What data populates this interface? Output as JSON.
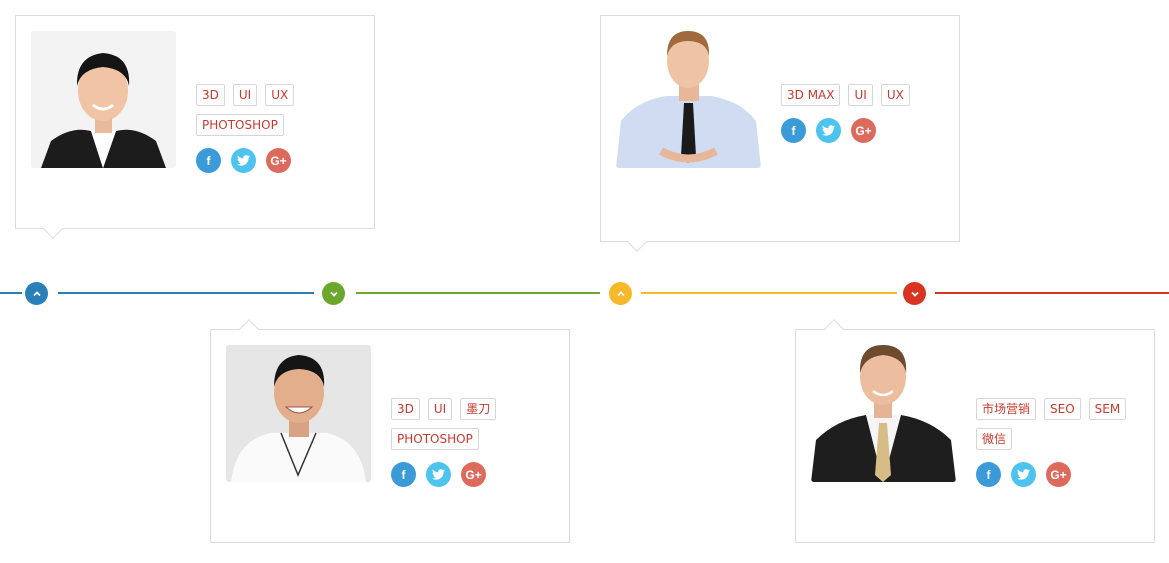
{
  "colors": {
    "blue": "#2980b9",
    "green": "#6aa72a",
    "yellow": "#f7b82a",
    "red": "#d93321",
    "tag_text": "#c83a2e"
  },
  "timeline": {
    "nodes": [
      {
        "color": "#2980b9",
        "icon": "chevron-up-icon"
      },
      {
        "color": "#6aa72a",
        "icon": "chevron-down-icon"
      },
      {
        "color": "#f7b82a",
        "icon": "chevron-up-icon"
      },
      {
        "color": "#d93321",
        "icon": "chevron-down-icon"
      }
    ]
  },
  "cards": [
    {
      "photo": "man-in-black-suit-photo",
      "tags": [
        "3D",
        "UI",
        "UX",
        "PHOTOSHOP"
      ],
      "social": {
        "facebook": "f",
        "twitter": "twitter-bird-icon",
        "googleplus": "G+"
      }
    },
    {
      "photo": "man-in-white-tshirt-photo",
      "tags": [
        "3D",
        "UI",
        "墨刀",
        "PHOTOSHOP"
      ],
      "social": {
        "facebook": "f",
        "twitter": "twitter-bird-icon",
        "googleplus": "G+"
      }
    },
    {
      "photo": "man-in-blue-shirt-photo",
      "tags": [
        "3D MAX",
        "UI",
        "UX"
      ],
      "social": {
        "facebook": "f",
        "twitter": "twitter-bird-icon",
        "googleplus": "G+"
      }
    },
    {
      "photo": "man-in-suit-with-tie-photo",
      "tags": [
        "市场营销",
        "SEO",
        "SEM",
        "微信"
      ],
      "social": {
        "facebook": "f",
        "twitter": "twitter-bird-icon",
        "googleplus": "G+"
      }
    }
  ],
  "social_glyphs": {
    "facebook": "f",
    "googleplus": "G+"
  }
}
